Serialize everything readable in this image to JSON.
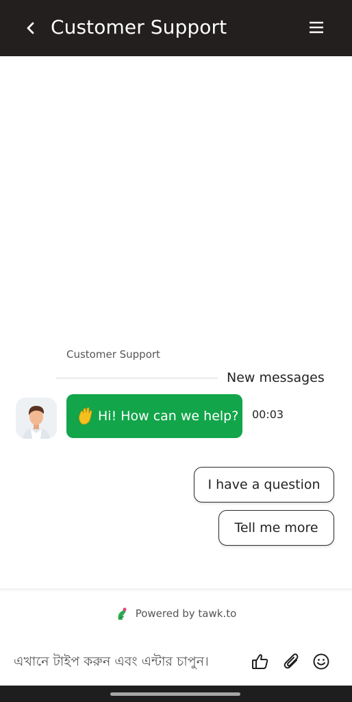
{
  "header": {
    "title": "Customer Support",
    "back_icon": "chevron-left-icon",
    "menu_icon": "hamburger-menu-icon",
    "background_color": "#231f1e"
  },
  "chat": {
    "sender_name": "Customer Support",
    "new_messages_label": "New messages",
    "message": {
      "emoji_icon": "waving-hand-icon",
      "text": "Hi! How can we help?",
      "time": "00:03",
      "bubble_color": "#12a54a"
    },
    "quick_replies": [
      {
        "label": "I have a question"
      },
      {
        "label": "Tell me more"
      }
    ]
  },
  "footer": {
    "powered_by": "Powered by tawk.to",
    "input_placeholder": "এখানে টাইপ করুন এবং এন্টার চাপুন।",
    "icons": [
      "thumbs-up-icon",
      "paperclip-icon",
      "smiley-icon"
    ]
  }
}
